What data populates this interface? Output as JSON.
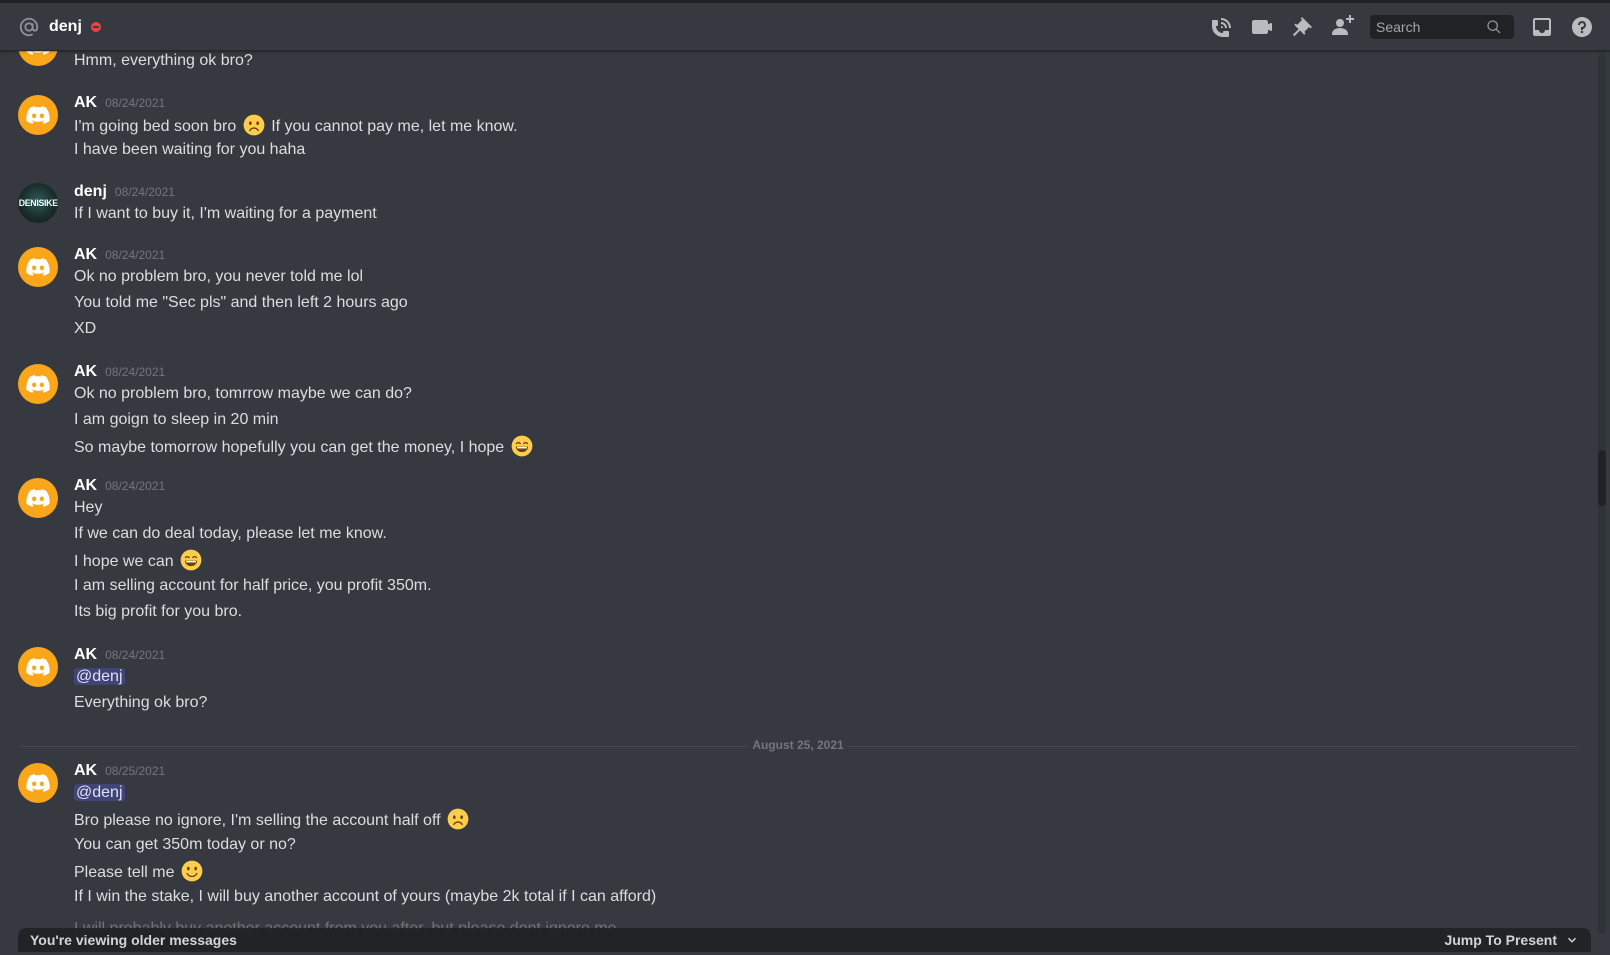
{
  "header": {
    "channel_name": "denj",
    "status": "do-not-disturb",
    "status_color": "#ed4245",
    "search_placeholder": "Search",
    "icons": [
      "at-icon",
      "phone-icon",
      "video-icon",
      "pin-icon",
      "add-friend-icon",
      "search-icon",
      "inbox-icon",
      "help-icon"
    ]
  },
  "messages": [
    {
      "lines": [
        "Hmm, everything ok bro?"
      ]
    },
    {
      "author": "AK",
      "timestamp": "08/24/2021",
      "lines": [
        "I'm going bed soon bro",
        "If you cannot pay me, let me know.",
        "I have been waiting for you haha"
      ]
    },
    {
      "author": "denj",
      "avatar_text": "DENISIKE",
      "timestamp": "08/24/2021",
      "lines": [
        "If I want to buy it, I'm waiting for a payment"
      ]
    },
    {
      "author": "AK",
      "timestamp": "08/24/2021",
      "lines": [
        "Ok no problem bro, you never told me lol",
        "You told me \"Sec pls\" and then left 2 hours ago",
        "XD"
      ]
    },
    {
      "author": "AK",
      "timestamp": "08/24/2021",
      "lines": [
        "Ok no problem bro, tomrrow maybe we can do?",
        "I am goign to sleep in 20 min",
        "So maybe tomorrow hopefully you can get the money, I hope"
      ]
    },
    {
      "author": "AK",
      "timestamp": "08/24/2021",
      "lines": [
        "Hey",
        "If we can do deal today, please let me know.",
        "I hope we can",
        "I am selling account for half price, you profit 350m.",
        "Its big profit for you bro."
      ]
    },
    {
      "author": "AK",
      "timestamp": "08/24/2021",
      "lines": [
        "@denj",
        "Everything ok bro?"
      ]
    },
    {
      "author": "AK",
      "timestamp": "08/25/2021",
      "lines": [
        "@denj",
        "Bro please no ignore, I'm selling the account half off",
        "You can get 350m today or no?",
        "Please tell me",
        "If I win the stake, I will buy another account of yours (maybe 2k total if I can afford)",
        "I will probably buy another account from you after, but please dont ignore me"
      ]
    }
  ],
  "date_divider": "August 25, 2021",
  "footer": {
    "older_text": "You're viewing older messages",
    "jump_label": "Jump To Present"
  },
  "colors": {
    "background": "#36393f",
    "header_bg": "#36393f",
    "discord_avatar": "#faa61a",
    "mention_bg": "#3c4270",
    "text": "#dcddde",
    "muted": "#72767d"
  }
}
